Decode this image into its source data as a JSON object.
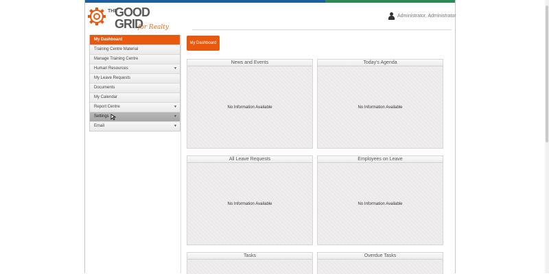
{
  "header": {
    "logo": {
      "line1": "THE",
      "line2": "GOOD",
      "line3": "GRID",
      "tagline": "for Realty"
    },
    "user": {
      "name": "Administrator, Administrator"
    }
  },
  "sidebar": {
    "items": [
      {
        "label": "My Dashboard",
        "caret": ""
      },
      {
        "label": "Training Centre Material",
        "caret": ""
      },
      {
        "label": "Manage Training Centre",
        "caret": ""
      },
      {
        "label": "Human Resources",
        "caret": "▼"
      },
      {
        "label": "My Leave Requests",
        "caret": ""
      },
      {
        "label": "Documents",
        "caret": ""
      },
      {
        "label": "My Calendar",
        "caret": ""
      },
      {
        "label": "Report Centre",
        "caret": "▼"
      },
      {
        "label": "Settings",
        "caret": "▼"
      },
      {
        "label": "Email",
        "caret": "▼"
      }
    ]
  },
  "main": {
    "dashboard_button": "My Dashboard",
    "panels": [
      {
        "title": "News and Events",
        "message": "No Information Available"
      },
      {
        "title": "Today's Agenda",
        "message": "No Information Available"
      },
      {
        "title": "All Leave Requests",
        "message": "No Information Available"
      },
      {
        "title": "Employees on Leave",
        "message": "No Information Available"
      },
      {
        "title": "Tasks",
        "message": ""
      },
      {
        "title": "Overdue Tasks",
        "message": ""
      }
    ]
  },
  "colors": {
    "accent": "#e8580f",
    "topbar_blue": "#1e5f9e",
    "topbar_green": "#2e8b57"
  }
}
